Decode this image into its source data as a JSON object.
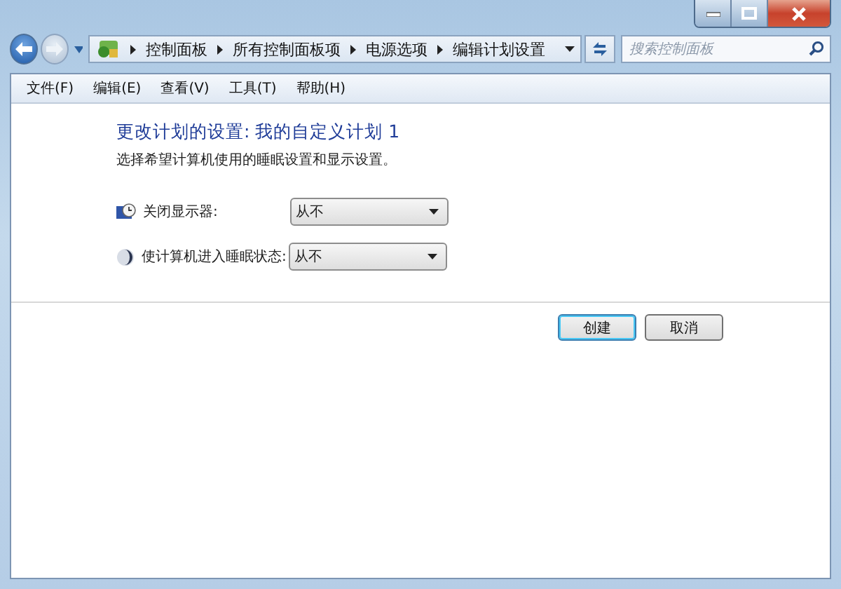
{
  "address_bar": {
    "breadcrumbs": [
      "控制面板",
      "所有控制面板项",
      "电源选项",
      "编辑计划设置"
    ]
  },
  "search": {
    "placeholder": "搜索控制面板"
  },
  "menu_bar": [
    "文件(F)",
    "编辑(E)",
    "查看(V)",
    "工具(T)",
    "帮助(H)"
  ],
  "heading": "更改计划的设置: 我的自定义计划 1",
  "description": "选择希望计算机使用的睡眠设置和显示设置。",
  "settings": [
    {
      "label": "关闭显示器:",
      "value": "从不"
    },
    {
      "label": "使计算机进入睡眠状态:",
      "value": "从不"
    }
  ],
  "buttons": [
    {
      "label": "创建",
      "default": true
    },
    {
      "label": "取消",
      "default": false
    }
  ]
}
